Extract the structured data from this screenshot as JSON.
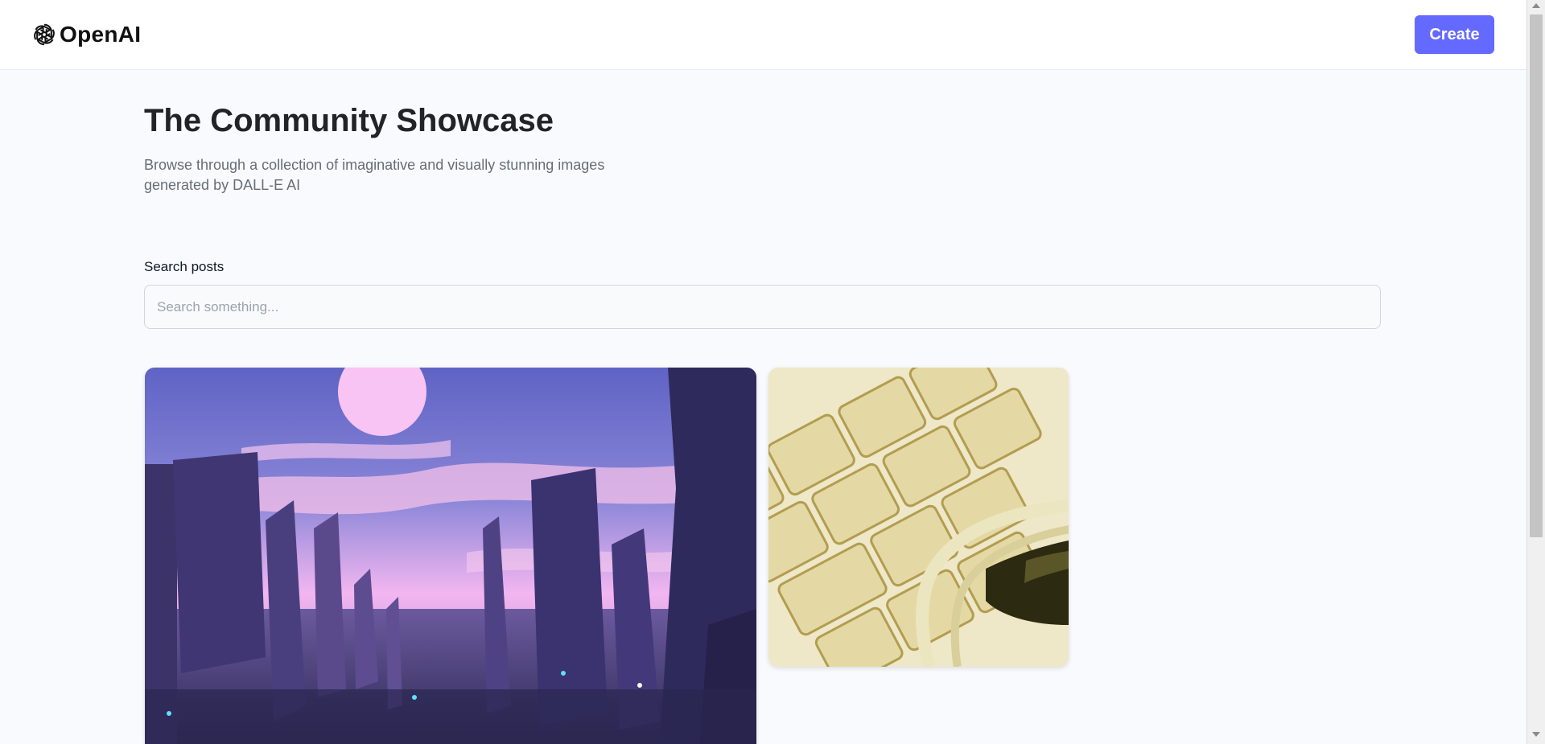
{
  "header": {
    "brand": "OpenAI",
    "create_label": "Create"
  },
  "hero": {
    "title": "The Community Showcase",
    "subtitle": "Browse through a collection of imaginative and visually stunning images generated by DALL-E AI"
  },
  "search": {
    "label": "Search posts",
    "value": "",
    "placeholder": "Search something..."
  },
  "gallery": {
    "items": [
      {
        "subject": "purple city skyline at sunset"
      },
      {
        "subject": "close-up of keyboard keys with cable"
      }
    ]
  },
  "colors": {
    "accent": "#6469ff",
    "page_bg": "#f9fafe",
    "title": "#222328",
    "muted": "#666e75"
  },
  "icons": {
    "logo": "openai-logo-icon"
  }
}
